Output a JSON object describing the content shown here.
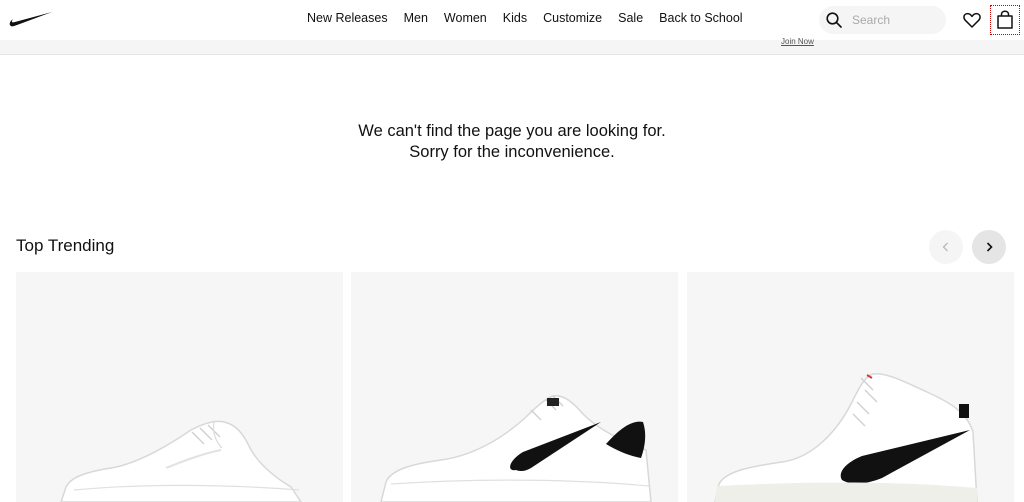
{
  "header": {
    "nav": [
      "New Releases",
      "Men",
      "Women",
      "Kids",
      "Customize",
      "Sale",
      "Back to School"
    ],
    "search_placeholder": "Search"
  },
  "promo": {
    "link": "Join Now"
  },
  "error": {
    "line1": "We can't find the page you are looking for.",
    "line2": "Sorry for the inconvenience."
  },
  "trending": {
    "title": "Top Trending"
  },
  "icons": {
    "logo": "swoosh-logo",
    "search": "search-icon",
    "favorites": "heart-icon",
    "bag": "shopping-bag-icon",
    "prev": "chevron-left-icon",
    "next": "chevron-right-icon"
  },
  "colors": {
    "accent": "#111111",
    "panel": "#f5f5f5"
  }
}
